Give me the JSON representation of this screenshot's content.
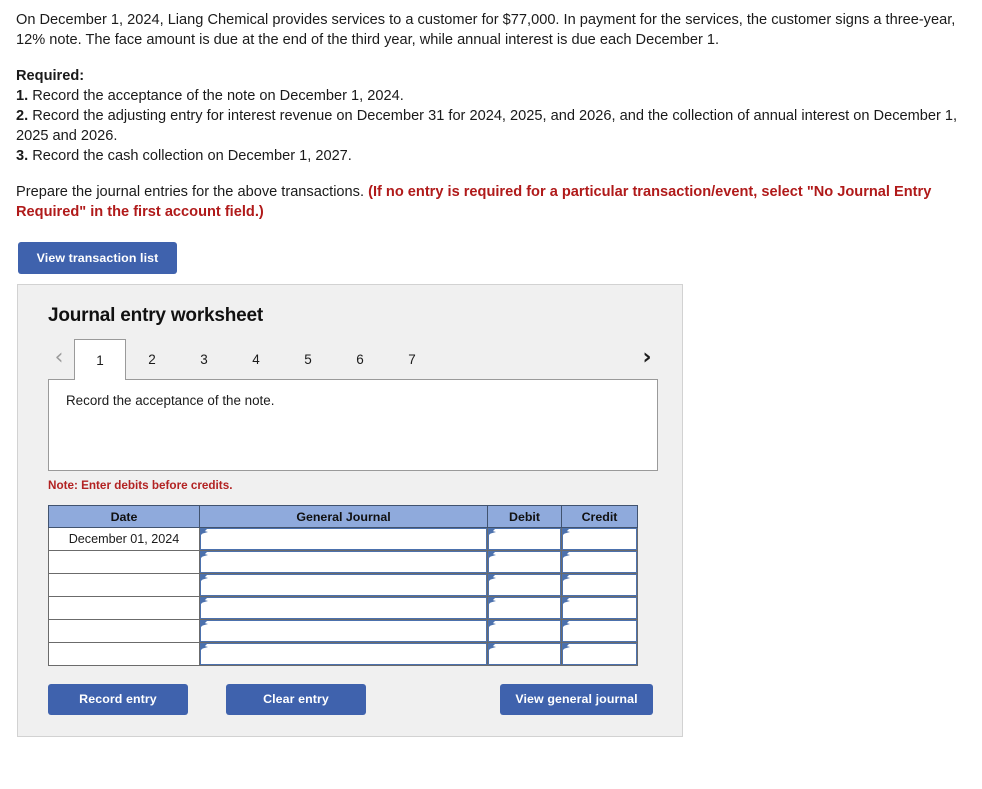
{
  "problem": {
    "intro": "On December 1, 2024, Liang Chemical provides services to a customer for $77,000. In payment for the services, the customer signs a three-year, 12% note. The face amount is due at the end of the third year, while annual interest is due each December 1.",
    "required_heading": "Required:",
    "requirements": [
      {
        "num": "1.",
        "text": "Record the acceptance of the note on December 1, 2024."
      },
      {
        "num": "2.",
        "text": "Record the adjusting entry for interest revenue on December 31 for 2024, 2025, and 2026, and the collection of annual interest on December 1, 2025 and 2026."
      },
      {
        "num": "3.",
        "text": "Record the cash collection on December 1, 2027."
      }
    ],
    "prepare_text": "Prepare the journal entries for the above transactions. ",
    "prepare_emphasis": "(If no entry is required for a particular transaction/event, select \"No Journal Entry Required\" in the first account field.)"
  },
  "toolbar": {
    "view_transaction_list_label": "View transaction list"
  },
  "worksheet": {
    "title": "Journal entry worksheet",
    "prev_icon": "chevron-left-icon",
    "next_icon": "chevron-right-icon",
    "tabs": [
      {
        "label": "1",
        "active": true
      },
      {
        "label": "2",
        "active": false
      },
      {
        "label": "3",
        "active": false
      },
      {
        "label": "4",
        "active": false
      },
      {
        "label": "5",
        "active": false
      },
      {
        "label": "6",
        "active": false
      },
      {
        "label": "7",
        "active": false
      }
    ],
    "description": "Record the acceptance of the note.",
    "note": "Note: Enter debits before credits.",
    "table": {
      "headers": [
        "Date",
        "General Journal",
        "Debit",
        "Credit"
      ],
      "rows": [
        {
          "date": "December 01, 2024",
          "general_journal": "",
          "debit": "",
          "credit": ""
        },
        {
          "date": "",
          "general_journal": "",
          "debit": "",
          "credit": ""
        },
        {
          "date": "",
          "general_journal": "",
          "debit": "",
          "credit": ""
        },
        {
          "date": "",
          "general_journal": "",
          "debit": "",
          "credit": ""
        },
        {
          "date": "",
          "general_journal": "",
          "debit": "",
          "credit": ""
        },
        {
          "date": "",
          "general_journal": "",
          "debit": "",
          "credit": ""
        }
      ]
    },
    "actions": {
      "record_entry_label": "Record entry",
      "clear_entry_label": "Clear entry",
      "view_general_journal_label": "View general journal"
    }
  },
  "colors": {
    "button_blue": "#3f62ad",
    "table_header_blue": "#8faadc",
    "panel_gray": "#f0f0f0",
    "note_red": "#b22222",
    "emphasis_red": "#b01a1a",
    "field_border_blue": "#4c71ad"
  }
}
